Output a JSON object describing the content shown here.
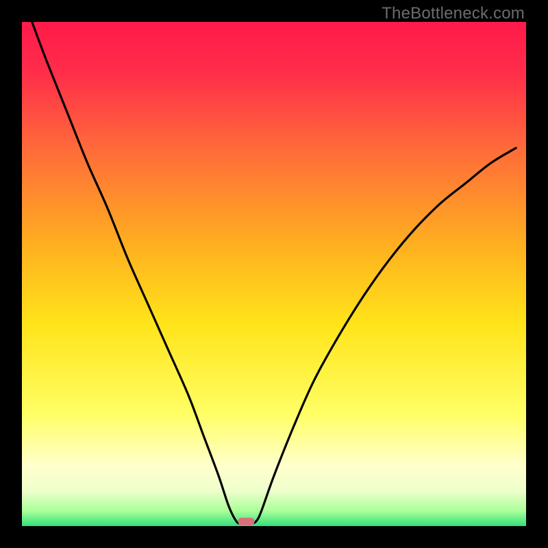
{
  "watermark": "TheBottleneck.com",
  "chart_data": {
    "type": "line",
    "title": "",
    "xlabel": "",
    "ylabel": "",
    "xlim": [
      0,
      1
    ],
    "ylim": [
      0,
      1
    ],
    "gradient_stops": [
      {
        "offset": 0.0,
        "color": "#ff1a4a"
      },
      {
        "offset": 0.1,
        "color": "#ff2d4a"
      },
      {
        "offset": 0.25,
        "color": "#ff6a3a"
      },
      {
        "offset": 0.45,
        "color": "#ffb21f"
      },
      {
        "offset": 0.6,
        "color": "#ffe41a"
      },
      {
        "offset": 0.78,
        "color": "#ffff66"
      },
      {
        "offset": 0.88,
        "color": "#ffffcc"
      },
      {
        "offset": 0.93,
        "color": "#eeffcc"
      },
      {
        "offset": 0.97,
        "color": "#aaff99"
      },
      {
        "offset": 1.0,
        "color": "#33e07a"
      }
    ],
    "series": [
      {
        "name": "bottleneck-curve",
        "x": [
          0.02,
          0.05,
          0.09,
          0.13,
          0.17,
          0.21,
          0.25,
          0.29,
          0.33,
          0.36,
          0.39,
          0.41,
          0.425,
          0.435,
          0.455,
          0.465,
          0.475,
          0.5,
          0.54,
          0.58,
          0.63,
          0.68,
          0.73,
          0.78,
          0.83,
          0.88,
          0.93,
          0.98
        ],
        "y": [
          1.0,
          0.92,
          0.82,
          0.72,
          0.63,
          0.53,
          0.44,
          0.35,
          0.26,
          0.18,
          0.1,
          0.04,
          0.01,
          0.005,
          0.005,
          0.01,
          0.03,
          0.1,
          0.2,
          0.29,
          0.38,
          0.46,
          0.53,
          0.59,
          0.64,
          0.68,
          0.72,
          0.75
        ]
      }
    ],
    "marker": {
      "x": 0.445,
      "y": 0.005,
      "color": "#d9707a"
    }
  }
}
